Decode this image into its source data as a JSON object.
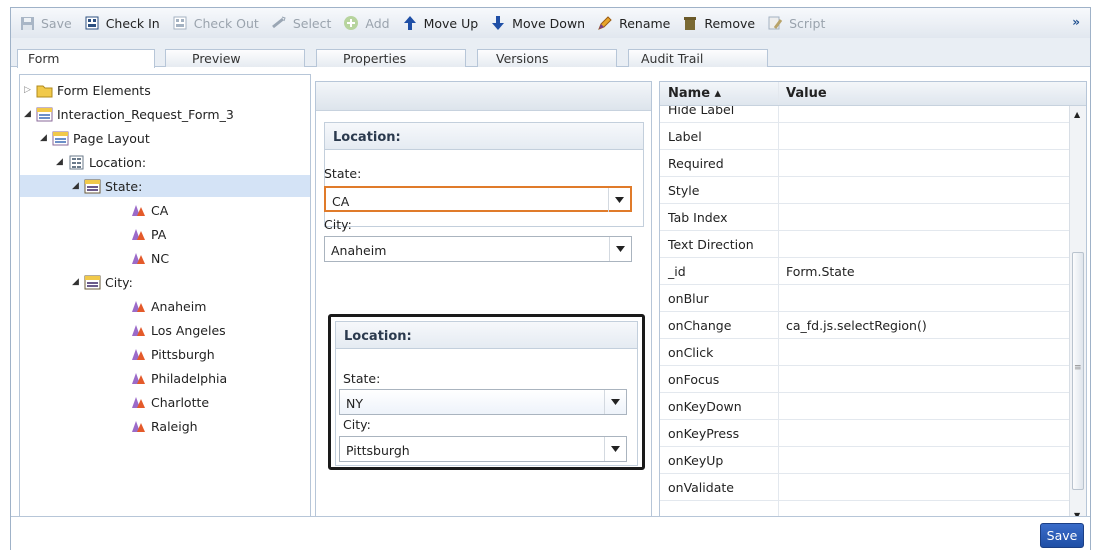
{
  "toolbar": {
    "save": "Save",
    "check_in": "Check In",
    "check_out": "Check Out",
    "select": "Select",
    "add": "Add",
    "move_up": "Move Up",
    "move_down": "Move Down",
    "rename": "Rename",
    "remove": "Remove",
    "script": "Script",
    "more": "»"
  },
  "tabs": {
    "form": "Form",
    "preview": "Preview",
    "properties": "Properties",
    "versions": "Versions",
    "audit_trail": "Audit Trail"
  },
  "tree": {
    "form_elements": "Form Elements",
    "form_name": "Interaction_Request_Form_3",
    "page_layout": "Page Layout",
    "location": "Location:",
    "state": "State:",
    "state_items": [
      "CA",
      "PA",
      "NC"
    ],
    "city": "City:",
    "city_items": [
      "Anaheim",
      "Los Angeles",
      "Pittsburgh",
      "Philadelphia",
      "Charlotte",
      "Raleigh"
    ]
  },
  "preview1": {
    "title": "Location:",
    "state_label": "State:",
    "state_value": "CA",
    "city_label": "City:",
    "city_value": "Anaheim"
  },
  "preview2": {
    "title": "Location:",
    "state_label": "State:",
    "state_value": "NY",
    "city_label": "City:",
    "city_value": "Pittsburgh"
  },
  "properties": {
    "col_name": "Name ▴",
    "col_value": "Value",
    "rows": [
      {
        "name": "Hide Label",
        "value": ""
      },
      {
        "name": "Label",
        "value": ""
      },
      {
        "name": "Required",
        "value": ""
      },
      {
        "name": "Style",
        "value": ""
      },
      {
        "name": "Tab Index",
        "value": ""
      },
      {
        "name": "Text Direction",
        "value": ""
      },
      {
        "name": "_id",
        "value": "Form.State"
      },
      {
        "name": "onBlur",
        "value": ""
      },
      {
        "name": "onChange",
        "value": "ca_fd.js.selectRegion()"
      },
      {
        "name": "onClick",
        "value": ""
      },
      {
        "name": "onFocus",
        "value": ""
      },
      {
        "name": "onKeyDown",
        "value": ""
      },
      {
        "name": "onKeyPress",
        "value": ""
      },
      {
        "name": "onKeyUp",
        "value": ""
      },
      {
        "name": "onValidate",
        "value": ""
      }
    ]
  },
  "footer": {
    "save": "Save"
  },
  "colors": {
    "accent": "#1f4fa6",
    "highlight_orange": "#e07b2a",
    "selection": "#d4e3f6"
  }
}
